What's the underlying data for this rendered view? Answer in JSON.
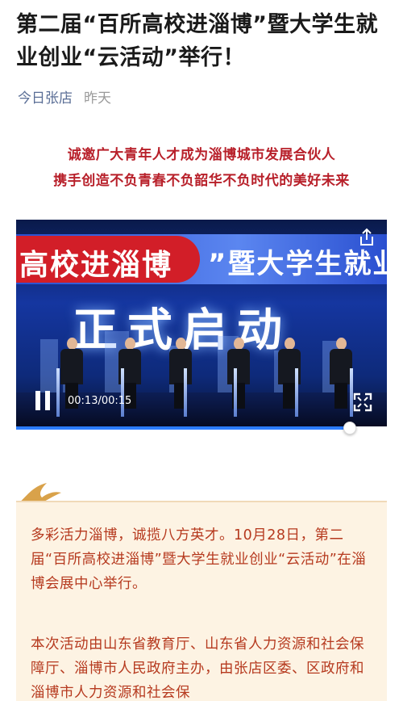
{
  "article": {
    "title": "第二届“百所高校进淄博”暨大学生就业创业“云活动”举行！",
    "source": "今日张店",
    "time": "昨天",
    "slogan_line1": "诚邀广大青年人才成为淄博城市发展合伙人",
    "slogan_line2": "携手创造不负青春不负韶华不负时代的美好未来",
    "paragraph1": "多彩活力淄博，诚揽八方英才。10月28日，第二届“百所高校进淄博”暨大学生就业创业“云活动”在淄博会展中心举行。",
    "paragraph2": "本次活动由山东省教育厅、山东省人力资源和社会保障厅、淄博市人民政府主办，由张店区委、区政府和淄博市人力资源和社会保"
  },
  "video": {
    "banner_red_text": "高校进淄博",
    "banner_blue_text": "”暨大学生就业",
    "main_text": "正式启动",
    "current_time": "00:13",
    "duration": "/00:15",
    "progress": 0.9,
    "icons": {
      "play_state": "pause-icon",
      "share": "share-icon",
      "fullscreen": "fullscreen-icon"
    }
  },
  "colors": {
    "slogan": "#b8202a",
    "paragraph": "#b63a1f",
    "card_bg": "#fdf3e3",
    "source_link": "#5a6e96",
    "progress": "#2b7cff"
  }
}
